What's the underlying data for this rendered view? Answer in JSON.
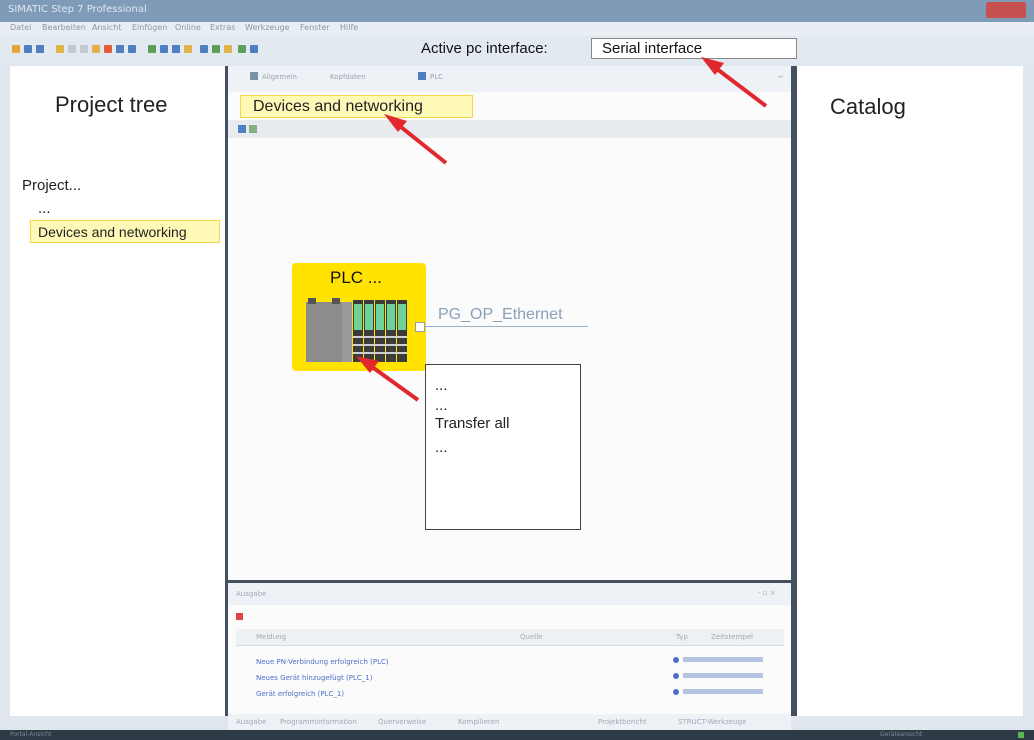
{
  "window": {
    "title": "SIMATIC Step 7 Professional"
  },
  "menu": {
    "items": [
      "Datei",
      "Bearbeiten",
      "Ansicht",
      "Einfügen",
      "Online",
      "Extras",
      "Werkzeuge",
      "Fenster",
      "Hilfe"
    ]
  },
  "toolbar": {
    "active_interface_label": "Active pc interface:",
    "active_interface_value": "Serial interface"
  },
  "project_tree": {
    "title": "Project tree",
    "root": "Project...",
    "ellipsis": "...",
    "selected": "Devices and networking"
  },
  "editor": {
    "tabs": [
      "Allgemein",
      "Kopfdaten",
      "PLC"
    ],
    "view_title": "Devices and networking",
    "device_label": "PLC ...",
    "network_label": "PG_OP_Ethernet",
    "context_menu": [
      "...",
      "...",
      "Transfer all",
      "..."
    ]
  },
  "catalog": {
    "title": "Catalog"
  },
  "output": {
    "title": "Ausgabe",
    "columns": [
      "Meldung",
      "Quelle",
      "Typ",
      "Zeitstempel"
    ],
    "rows": [
      "Neue PN-Verbindung erfolgreich (PLC)",
      "Neues Gerät hinzugefügt (PLC_1)",
      "Gerät erfolgreich (PLC_1)"
    ],
    "tabs": [
      "Ausgabe",
      "Programminformation",
      "Querverweise",
      "Kompilieren",
      "Projektbericht",
      "STRUCT-Werkzeuge"
    ]
  },
  "status": {
    "left": "Portal-Ansicht",
    "right": "Geräteansicht"
  },
  "colors": {
    "highlight": "#fff9b8",
    "plc_yellow": "#ffe200",
    "arrow_red": "#e0282e",
    "module_green": "#6ed39a",
    "network_blue": "#8aa0b8"
  }
}
